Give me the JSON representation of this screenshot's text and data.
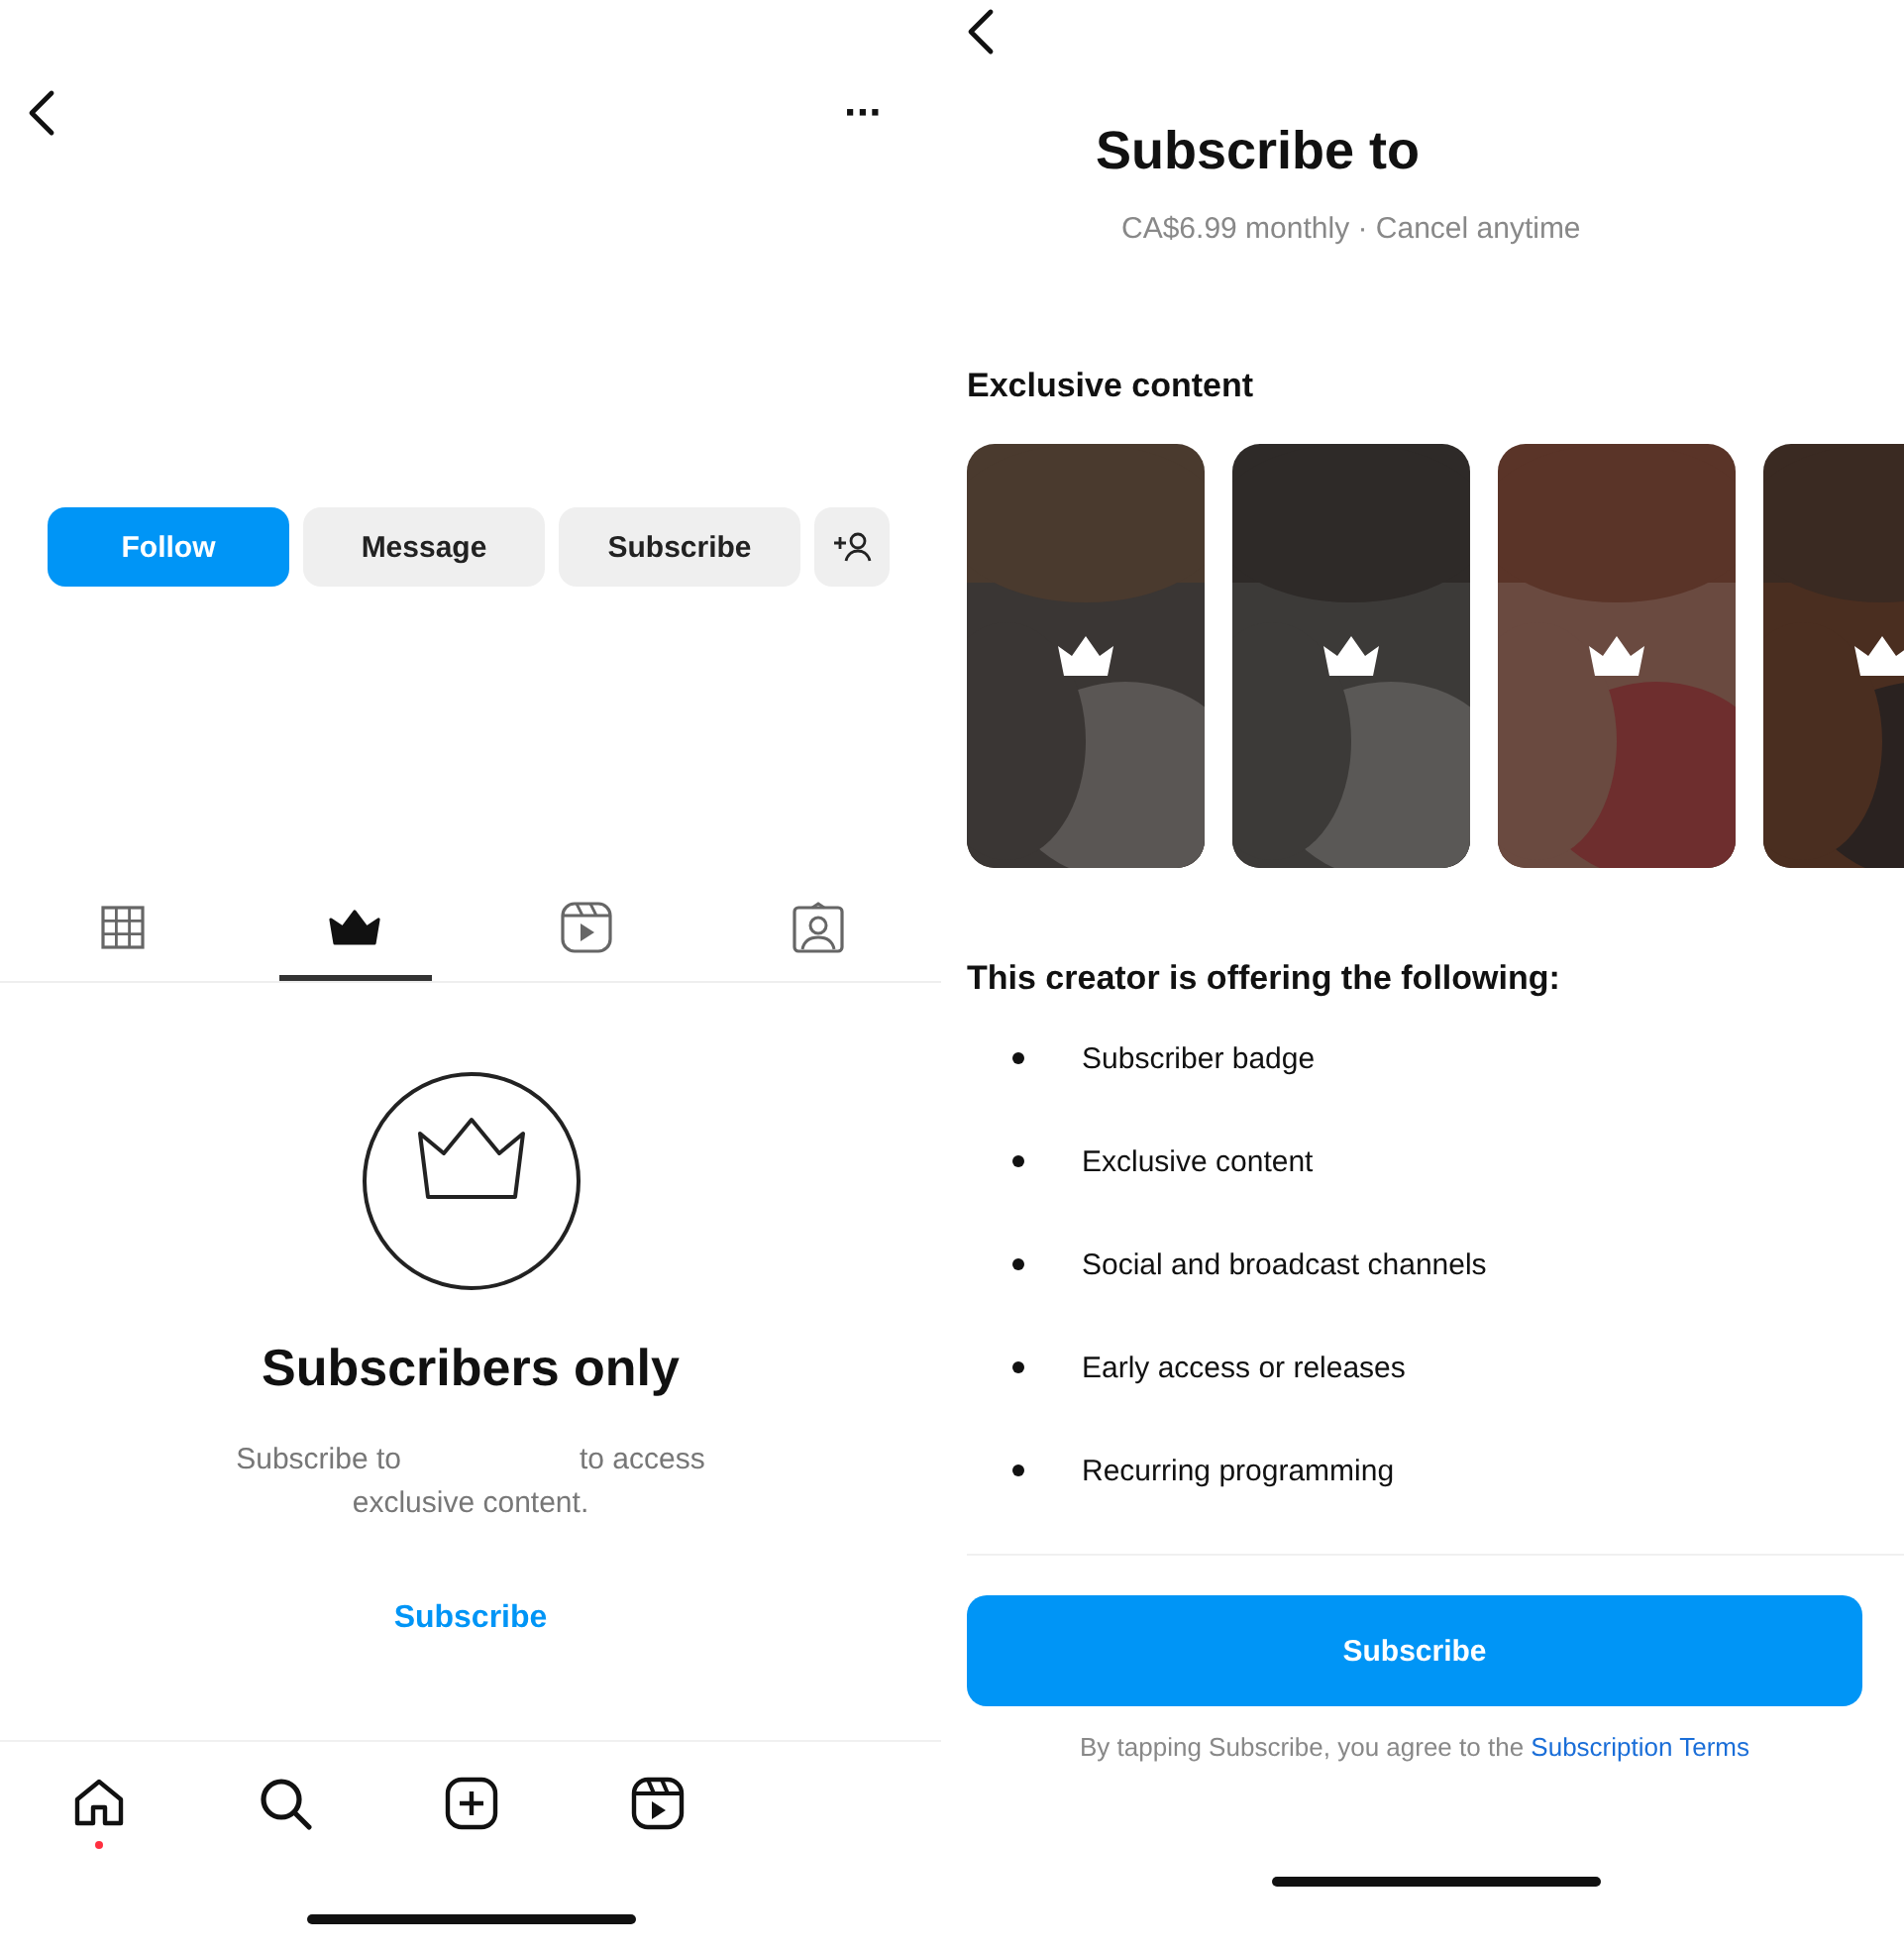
{
  "profile_screen": {
    "header": {
      "more": "···"
    },
    "actions": [
      {
        "kind": "primary",
        "label": "Follow"
      },
      {
        "kind": "secondary",
        "label": "Message"
      },
      {
        "kind": "secondary",
        "label": "Subscribe"
      },
      {
        "kind": "add-person"
      }
    ],
    "tabs": [
      {
        "kind": "grid",
        "selected": false
      },
      {
        "kind": "crown",
        "selected": true
      },
      {
        "kind": "reels",
        "selected": false
      },
      {
        "kind": "tagged",
        "selected": false
      }
    ],
    "empty_state": {
      "title": "Subscribers only",
      "text_before": "Subscribe to",
      "text_after": "to access exclusive content.",
      "link": "Subscribe"
    },
    "bottom_nav": [
      {
        "kind": "home",
        "notification": true
      },
      {
        "kind": "search",
        "notification": false
      },
      {
        "kind": "create",
        "notification": false
      },
      {
        "kind": "reels",
        "notification": false
      }
    ]
  },
  "subscribe_screen": {
    "title": "Subscribe to",
    "subtitle": "CA$6.99 monthly · Cancel anytime",
    "exclusive_content": {
      "title": "Exclusive content",
      "items": [
        {
          "kind": "picture",
          "locked": true
        },
        {
          "kind": "picture",
          "locked": true
        },
        {
          "kind": "picture",
          "locked": true
        },
        {
          "kind": "picture",
          "locked": true
        }
      ]
    },
    "offer_heading": "This creator is offering the following:",
    "offers": [
      "Subscriber badge",
      "Exclusive content",
      "Social and broadcast channels",
      "Early access or releases",
      "Recurring programming"
    ],
    "button": "Subscribe",
    "terms_text": "By tapping Subscribe, you agree to the",
    "terms_link": "Subscription Terms"
  }
}
